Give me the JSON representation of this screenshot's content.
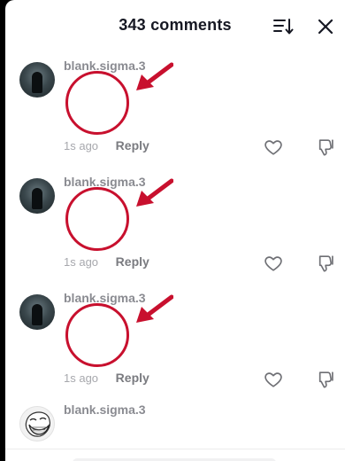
{
  "header": {
    "title": "343 comments",
    "sort_icon": "sort-icon",
    "close_icon": "close-icon"
  },
  "comments": [
    {
      "username": "blank.sigma.3",
      "time": "1s ago",
      "reply_label": "Reply",
      "annotation_color": "#c8102e"
    },
    {
      "username": "blank.sigma.3",
      "time": "1s ago",
      "reply_label": "Reply",
      "annotation_color": "#c8102e"
    },
    {
      "username": "blank.sigma.3",
      "time": "1s ago",
      "reply_label": "Reply",
      "annotation_color": "#c8102e"
    },
    {
      "username": "blank.sigma.3"
    }
  ],
  "icons": {
    "like": "heart-outline-icon",
    "dislike": "thumbs-down-icon"
  },
  "colors": {
    "username": "#8a8b91",
    "meta": "#a7a8ad",
    "accent_annotation": "#c8102e"
  }
}
